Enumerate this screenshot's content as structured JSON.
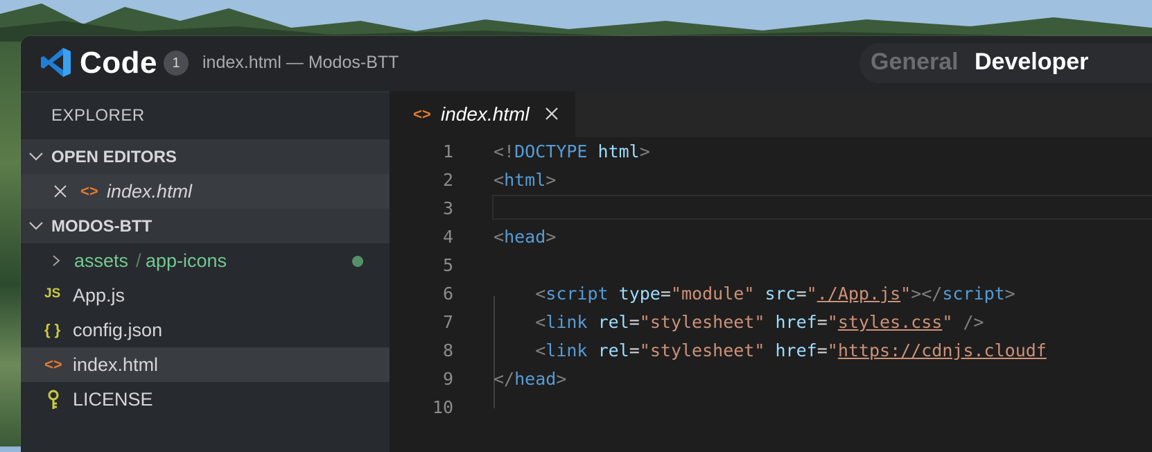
{
  "titlebar": {
    "app_name": "Code",
    "badge_count": "1",
    "window_title": "index.html — Modos-BTT",
    "segments": [
      "General",
      "Developer"
    ]
  },
  "sidebar": {
    "title": "EXPLORER",
    "open_editors": {
      "header": "OPEN EDITORS",
      "items": [
        {
          "label": "index.html",
          "icon": "html-file-icon"
        }
      ]
    },
    "project": {
      "header": "MODOS-BTT",
      "items": [
        {
          "label": "assets",
          "sub": "app-icons",
          "icon": "chevron-right-icon"
        },
        {
          "label": "App.js",
          "icon": "js-file-icon",
          "icon_text": "JS"
        },
        {
          "label": "config.json",
          "icon": "json-file-icon",
          "icon_text": "{ }"
        },
        {
          "label": "index.html",
          "icon": "html-file-icon",
          "icon_text": "<>"
        },
        {
          "label": "LICENSE",
          "icon": "license-file-icon"
        }
      ]
    }
  },
  "editor": {
    "tab": {
      "label": "index.html",
      "icon_text": "<>"
    },
    "line_numbers": [
      "1",
      "2",
      "3",
      "4",
      "5",
      "6",
      "7",
      "8",
      "9",
      "10"
    ],
    "code": {
      "l1": {
        "p1": "<!",
        "doctype": "DOCTYPE",
        "html": "html",
        "p2": ">"
      },
      "l2": {
        "p1": "<",
        "tag": "html",
        "p2": ">"
      },
      "l4": {
        "p1": "<",
        "tag": "head",
        "p2": ">"
      },
      "l6": {
        "indent": "    ",
        "p1": "<",
        "tag": "script",
        "attr1": "type",
        "eq1": "=",
        "q": "\"",
        "val1": "module",
        "attr2": "src",
        "val2": "./App.js",
        "p2": "></",
        "tag2": "script",
        "p3": ">"
      },
      "l7": {
        "indent": "    ",
        "p1": "<",
        "tag": "link",
        "attr1": "rel",
        "val1": "stylesheet",
        "attr2": "href",
        "val2": "styles.css",
        "p2": " />"
      },
      "l8": {
        "indent": "    ",
        "p1": "<",
        "tag": "link",
        "attr1": "rel",
        "val1": "stylesheet",
        "attr2": "href",
        "val2": "https://cdnjs.cloudf"
      },
      "l9": {
        "p1": "</",
        "tag": "head",
        "p2": ">"
      }
    }
  },
  "colors": {
    "accent_html": "#e37933",
    "js": "#cbcb41",
    "git_added": "#73c991"
  }
}
